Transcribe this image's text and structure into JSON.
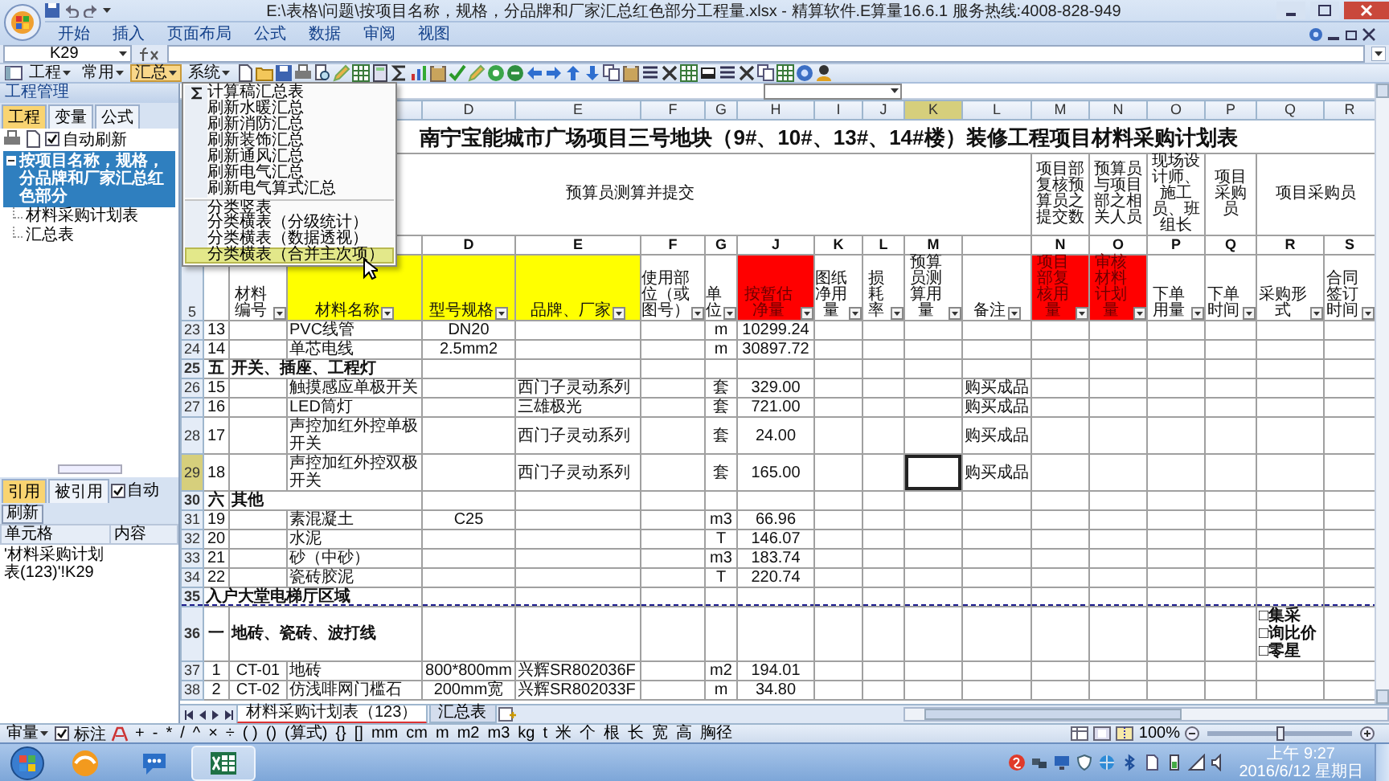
{
  "window": {
    "title": "E:\\表格\\问题\\按项目名称，规格，分品牌和厂家汇总红色部分工程量.xlsx - 精算软件.E算量16.6.1 服务热线:4008-828-949"
  },
  "ribbon_tabs": [
    "开始",
    "插入",
    "页面布局",
    "公式",
    "数据",
    "审阅",
    "视图"
  ],
  "formula_bar": {
    "name_box": "K29"
  },
  "toolbar": {
    "menus": [
      {
        "label": "工程",
        "open": false
      },
      {
        "label": "常用",
        "open": false
      },
      {
        "label": "汇总",
        "open": true
      },
      {
        "label": "系统",
        "open": false
      }
    ]
  },
  "menu": {
    "items": [
      {
        "label": "计算稿汇总表",
        "kind": "sum",
        "selected": false,
        "separator_before": false
      },
      {
        "label": "刷新水暖汇总",
        "kind": "plain",
        "selected": false,
        "separator_before": false
      },
      {
        "label": "刷新消防汇总",
        "kind": "plain",
        "selected": false,
        "separator_before": false
      },
      {
        "label": "刷新装饰汇总",
        "kind": "plain",
        "selected": false,
        "separator_before": false
      },
      {
        "label": "刷新通风汇总",
        "kind": "plain",
        "selected": false,
        "separator_before": false
      },
      {
        "label": "刷新电气汇总",
        "kind": "plain",
        "selected": false,
        "separator_before": false
      },
      {
        "label": "刷新电气算式汇总",
        "kind": "plain",
        "selected": false,
        "separator_before": false
      },
      {
        "label": "分类竖表",
        "kind": "plain",
        "selected": false,
        "separator_before": true
      },
      {
        "label": "分类横表（分级统计）",
        "kind": "plain",
        "selected": false,
        "separator_before": false
      },
      {
        "label": "分类横表（数据透视）",
        "kind": "plain",
        "selected": false,
        "separator_before": false
      },
      {
        "label": "分类横表（合并主次项）",
        "kind": "plain",
        "selected": true,
        "separator_before": false
      }
    ]
  },
  "left_panel": {
    "title": "工程管理",
    "tabs": [
      {
        "label": "工程",
        "selected": true
      },
      {
        "label": "变量",
        "selected": false
      },
      {
        "label": "公式",
        "selected": false
      }
    ],
    "auto_refresh": {
      "label": "自动刷新",
      "checked": true
    },
    "tree": [
      {
        "label": "按项目名称，规格，分品牌和厂家汇总红色部分",
        "selected": true,
        "children": [
          {
            "label": "材料采购计划表",
            "selected": false
          },
          {
            "label": "汇总表",
            "selected": false
          }
        ]
      }
    ],
    "references": {
      "tabs": [
        {
          "label": "引用",
          "selected": true
        },
        {
          "label": "被引用",
          "selected": false
        }
      ],
      "auto": {
        "label": "自动",
        "checked": true
      },
      "refresh_button": "刷新",
      "columns": [
        "单元格",
        "内容"
      ],
      "rows": [
        {
          "cell": "'材料采购计划表(123)'!K29"
        }
      ]
    }
  },
  "sheet": {
    "columns": [
      {
        "letter": "D",
        "selected": false
      },
      {
        "letter": "E",
        "selected": false
      },
      {
        "letter": "F",
        "selected": false
      },
      {
        "letter": "G",
        "selected": false
      },
      {
        "letter": "H",
        "selected": false
      },
      {
        "letter": "I",
        "selected": false
      },
      {
        "letter": "J",
        "selected": false
      },
      {
        "letter": "K",
        "selected": true
      },
      {
        "letter": "L",
        "selected": false
      },
      {
        "letter": "M",
        "selected": false
      },
      {
        "letter": "N",
        "selected": false
      },
      {
        "letter": "O",
        "selected": false
      },
      {
        "letter": "P",
        "selected": false
      },
      {
        "letter": "Q",
        "selected": false
      },
      {
        "letter": "R",
        "selected": false
      }
    ],
    "title": "南宁宝能城市广场项目三号地块（9#、10#、13#、14#楼）装修工程项目材料采购计划表",
    "groups": {
      "B": "预算员测算并提交",
      "M": "项目部复核预算员之提交数",
      "N": "预算员与项目部之相关人员",
      "O": "现场设计师、施工员、班组长",
      "P": "项目采购员",
      "Q": "项目采购员"
    },
    "codes": {
      "D": "D",
      "E": "E",
      "F": "F",
      "G": "G",
      "H": "J",
      "I": "K",
      "J": "L",
      "K": "M",
      "M": "N",
      "N": "O",
      "O": "P",
      "P": "Q",
      "Q": "R",
      "R": "S"
    },
    "header": {
      "num": "5",
      "cells": {
        "B": {
          "text": "材料编号"
        },
        "C": {
          "text": "材料名称",
          "color": "#ffff00"
        },
        "D": {
          "text": "型号规格",
          "color": "#ffff00"
        },
        "E": {
          "text": "品牌、厂家",
          "color": "#ffff00"
        },
        "F": {
          "text": "使用部位（或图号）"
        },
        "G": {
          "text": "单位"
        },
        "H": {
          "text": "按暂估净量",
          "color": "#ff0000"
        },
        "I": {
          "text": "图纸净用量"
        },
        "J": {
          "text": "损耗率"
        },
        "K": {
          "text": "预算员测算用量"
        },
        "L": {
          "text": "备注"
        },
        "M": {
          "text": "项目部复核用量",
          "color": "#ff0000"
        },
        "N": {
          "text": "审核材料计划量",
          "color": "#ff0000"
        },
        "O": {
          "text": "下单用量"
        },
        "P": {
          "text": "下单时间"
        },
        "Q": {
          "text": "采购形式"
        },
        "R": {
          "text": "合同签订时间"
        }
      }
    },
    "rows": [
      {
        "num": "23",
        "kind": "item",
        "selected": false,
        "page_break": false,
        "cells": {
          "A": "13",
          "C": "PVC线管",
          "D": "DN20",
          "G": "m",
          "H": "10299.24"
        }
      },
      {
        "num": "24",
        "kind": "item",
        "selected": false,
        "page_break": false,
        "cells": {
          "A": "14",
          "C": "单芯电线",
          "D": "2.5mm2",
          "G": "m",
          "H": "30897.72"
        }
      },
      {
        "num": "25",
        "kind": "section",
        "selected": false,
        "page_break": false,
        "cells": {
          "A": "五",
          "B": "开关、插座、工程灯"
        }
      },
      {
        "num": "26",
        "kind": "item",
        "selected": false,
        "page_break": false,
        "cells": {
          "A": "15",
          "C": "触摸感应单极开关",
          "E": "西门子灵动系列",
          "G": "套",
          "H": "329.00",
          "L": "购买成品"
        }
      },
      {
        "num": "27",
        "kind": "item",
        "selected": false,
        "page_break": false,
        "cells": {
          "A": "16",
          "C": "LED筒灯",
          "E": "三雄极光",
          "G": "套",
          "H": "721.00",
          "L": "购买成品"
        }
      },
      {
        "num": "28",
        "kind": "item",
        "selected": false,
        "page_break": false,
        "cells": {
          "A": "17",
          "C": "声控加红外控单极开关",
          "E": "西门子灵动系列",
          "G": "套",
          "H": "24.00",
          "L": "购买成品"
        }
      },
      {
        "num": "29",
        "kind": "item",
        "selected": true,
        "page_break": false,
        "cells": {
          "A": "18",
          "C": "声控加红外控双极开关",
          "E": "西门子灵动系列",
          "G": "套",
          "H": "165.00",
          "L": "购买成品"
        }
      },
      {
        "num": "30",
        "kind": "section",
        "selected": false,
        "page_break": false,
        "cells": {
          "A": "六",
          "B": "其他"
        }
      },
      {
        "num": "31",
        "kind": "item",
        "selected": false,
        "page_break": false,
        "cells": {
          "A": "19",
          "C": "素混凝土",
          "D": "C25",
          "G": "m3",
          "H": "66.96"
        }
      },
      {
        "num": "32",
        "kind": "item",
        "selected": false,
        "page_break": false,
        "cells": {
          "A": "20",
          "C": "水泥",
          "G": "T",
          "H": "146.07"
        }
      },
      {
        "num": "33",
        "kind": "item",
        "selected": false,
        "page_break": false,
        "cells": {
          "A": "21",
          "C": "砂（中砂）",
          "G": "m3",
          "H": "183.74"
        }
      },
      {
        "num": "34",
        "kind": "item",
        "selected": false,
        "page_break": false,
        "cells": {
          "A": "22",
          "C": "瓷砖胶泥",
          "G": "T",
          "H": "220.74"
        }
      },
      {
        "num": "35",
        "kind": "section",
        "selected": false,
        "page_break": true,
        "cells": {
          "A": "入户大堂电梯厅区域"
        }
      },
      {
        "num": "36",
        "kind": "section",
        "selected": false,
        "page_break": false,
        "cells": {
          "A": "一",
          "B": "地砖、瓷砖、波打线",
          "Q": [
            "□集采",
            "□询比价",
            "□零星"
          ]
        }
      },
      {
        "num": "37",
        "kind": "item",
        "selected": false,
        "page_break": false,
        "cells": {
          "A": "1",
          "B": "CT-01",
          "C": "地砖",
          "D": "800*800mm",
          "E": "兴辉SR802036F",
          "G": "m2",
          "H": "194.01"
        }
      },
      {
        "num": "38",
        "kind": "item",
        "selected": false,
        "page_break": false,
        "cells": {
          "A": "2",
          "B": "CT-02",
          "C": "仿浅啡网门槛石",
          "D": "200mm宽",
          "E": "兴辉SR802033F",
          "G": "m",
          "H": "34.80"
        }
      }
    ]
  },
  "sheet_tabs": [
    {
      "label": "材料采购计划表（123）",
      "selected": true
    },
    {
      "label": "汇总表",
      "selected": false
    }
  ],
  "bottom_bar": {
    "review": "审量",
    "mark": {
      "label": "标注",
      "checked": true
    },
    "symbols": [
      "+",
      "-",
      "*",
      "/",
      "^",
      "×",
      "÷",
      "( )",
      "()",
      "(算式)",
      "{}",
      "[]",
      "mm",
      "cm",
      "m",
      "m2",
      "m3",
      "kg",
      "t",
      "米",
      "个",
      "根",
      "长",
      "宽",
      "高",
      "胸径"
    ],
    "zoom": "100%",
    "zoom_slider": {
      "level": 0.5
    }
  },
  "taskbar": {
    "apps": [
      {
        "kind": "browser",
        "active": false
      },
      {
        "kind": "chat",
        "active": false
      },
      {
        "kind": "spreadsheet",
        "active": true
      }
    ],
    "clock": {
      "time": "上午 9:27",
      "date": "2016/6/12 星期日"
    }
  }
}
